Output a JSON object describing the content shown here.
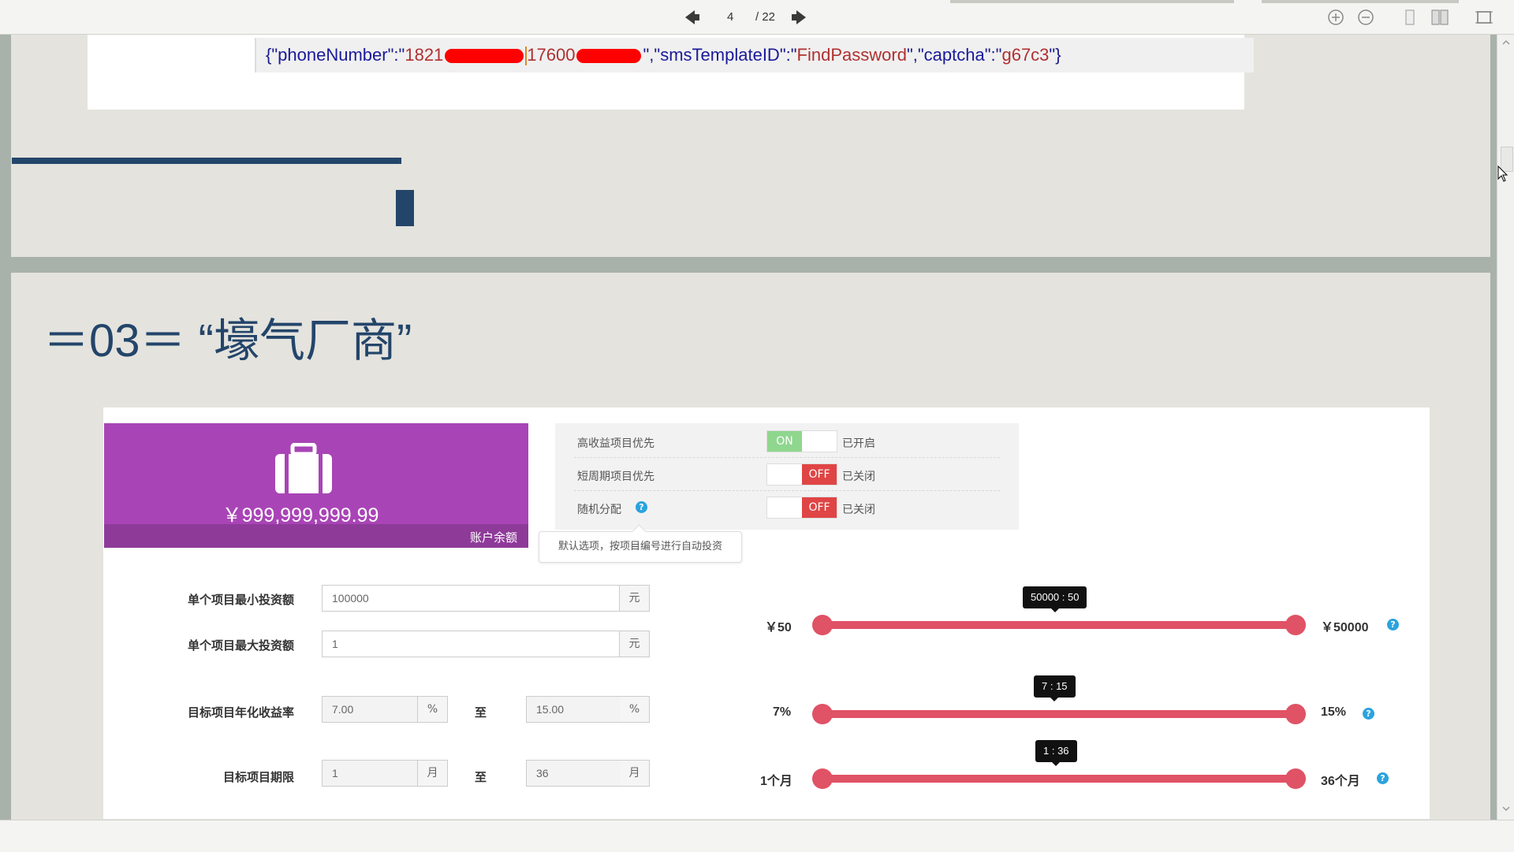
{
  "toolbar": {
    "page_current": "4",
    "page_total": "/ 22",
    "icons": [
      "prev-arrow-icon",
      "next-arrow-icon",
      "zoom-in-icon",
      "zoom-out-icon",
      "single-page-icon",
      "two-page-icon",
      "fit-page-icon"
    ]
  },
  "code": {
    "open": "{\"",
    "key1": "phoneNumber",
    "mid1": "\":\"",
    "val1a": "1821",
    "val1b": "17600",
    "mid2": "\",\"",
    "key2": "smsTemplateID",
    "mid3": "\":\"",
    "val2": "FindPassword",
    "mid4": "\",\"",
    "key3": "captcha",
    "mid5": "\":\"",
    "val3": "g67c3",
    "close": "\"}"
  },
  "section": {
    "title": "＝03＝ “壕气厂商”"
  },
  "balance": {
    "amount": "￥999,999,999.99",
    "label": "账户余额"
  },
  "options": [
    {
      "label": "高收益项目优先",
      "switch": "ON",
      "status": "已开启"
    },
    {
      "label": "短周期项目优先",
      "switch": "OFF",
      "status": "已关闭"
    },
    {
      "label": "随机分配",
      "switch": "OFF",
      "status": "已关闭"
    }
  ],
  "tooltip": "默认选项，按项目编号进行自动投资",
  "form": {
    "min_invest_label": "单个项目最小投资额",
    "min_invest_value": "100000",
    "max_invest_label": "单个项目最大投资额",
    "max_invest_value": "1",
    "currency_unit": "元",
    "rate_label": "目标项目年化收益率",
    "rate_from": "7.00",
    "rate_to": "15.00",
    "rate_unit": "%",
    "term_label": "目标项目期限",
    "term_from": "1",
    "term_to": "36",
    "term_unit": "月",
    "to_word": "至"
  },
  "sliders": [
    {
      "min_label": "￥50",
      "max_label": "￥50000",
      "tip": "50000 : 50"
    },
    {
      "min_label": "7%",
      "max_label": "15%",
      "tip": "7 : 15"
    },
    {
      "min_label": "1个月",
      "max_label": "36个月",
      "tip": "1 : 36"
    }
  ],
  "colors": {
    "accent_purple": "#a944b6",
    "slider_red": "#e05265",
    "switch_on": "#8fd68f",
    "switch_off": "#e04545",
    "heading_navy": "#23456a"
  }
}
